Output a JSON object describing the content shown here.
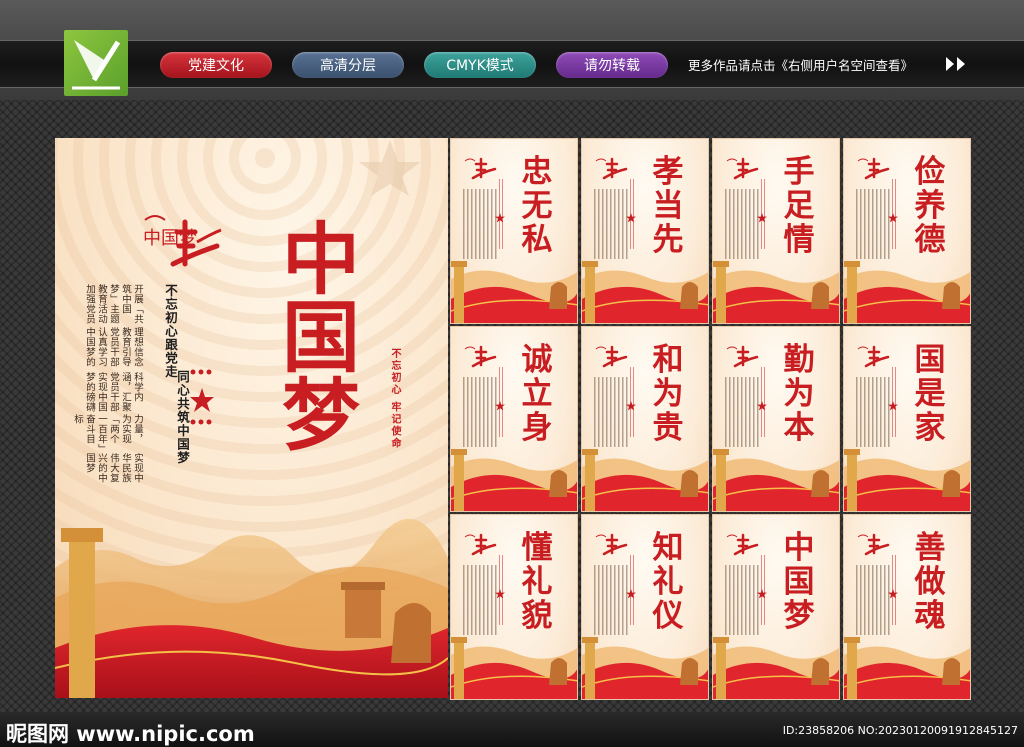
{
  "header": {
    "tags": [
      "党建文化",
      "高清分层",
      "CMYK模式",
      "请勿转载"
    ],
    "notice": "更多作品请点击《右侧用户名空间查看》"
  },
  "main_poster": {
    "title": "中国梦",
    "slogan_1": "不忘初心跟党走",
    "slogan_2": "同心共筑中国梦",
    "tagline": "不忘初心 牢记使命",
    "body_lines": [
      "开展「共筑中国梦」主题教育活动加强党员",
      "理想信念教育引导党员干部认真学习中国梦的",
      "科学内涵，汇聚党员干部实现中国梦的磅礴",
      "力量，为实现「两个一百年」奋斗目标",
      "实现中华民族伟大复兴的中国梦"
    ],
    "logo_text": "中国梦"
  },
  "small_posters": [
    {
      "title": "忠无私"
    },
    {
      "title": "孝当先"
    },
    {
      "title": "手足情"
    },
    {
      "title": "俭养德"
    },
    {
      "title": "诚立身"
    },
    {
      "title": "和为贵"
    },
    {
      "title": "勤为本"
    },
    {
      "title": "国是家"
    },
    {
      "title": "懂礼貌"
    },
    {
      "title": "知礼仪"
    },
    {
      "title": "中国梦"
    },
    {
      "title": "善做魂"
    }
  ],
  "footer": {
    "site": "昵图网 www.nipic.com",
    "id_text": "ID:23858206 NO:20230120091912845127"
  },
  "colors": {
    "primary_red": "#c81e22",
    "poster_bg": "#fbe6cc",
    "frame_bg": "#3a3a3a"
  },
  "icons": [
    "pen-logo-icon",
    "double-arrow-icon",
    "star-icon",
    "great-wall-scene",
    "huabiao-pillar",
    "stone-lion"
  ]
}
